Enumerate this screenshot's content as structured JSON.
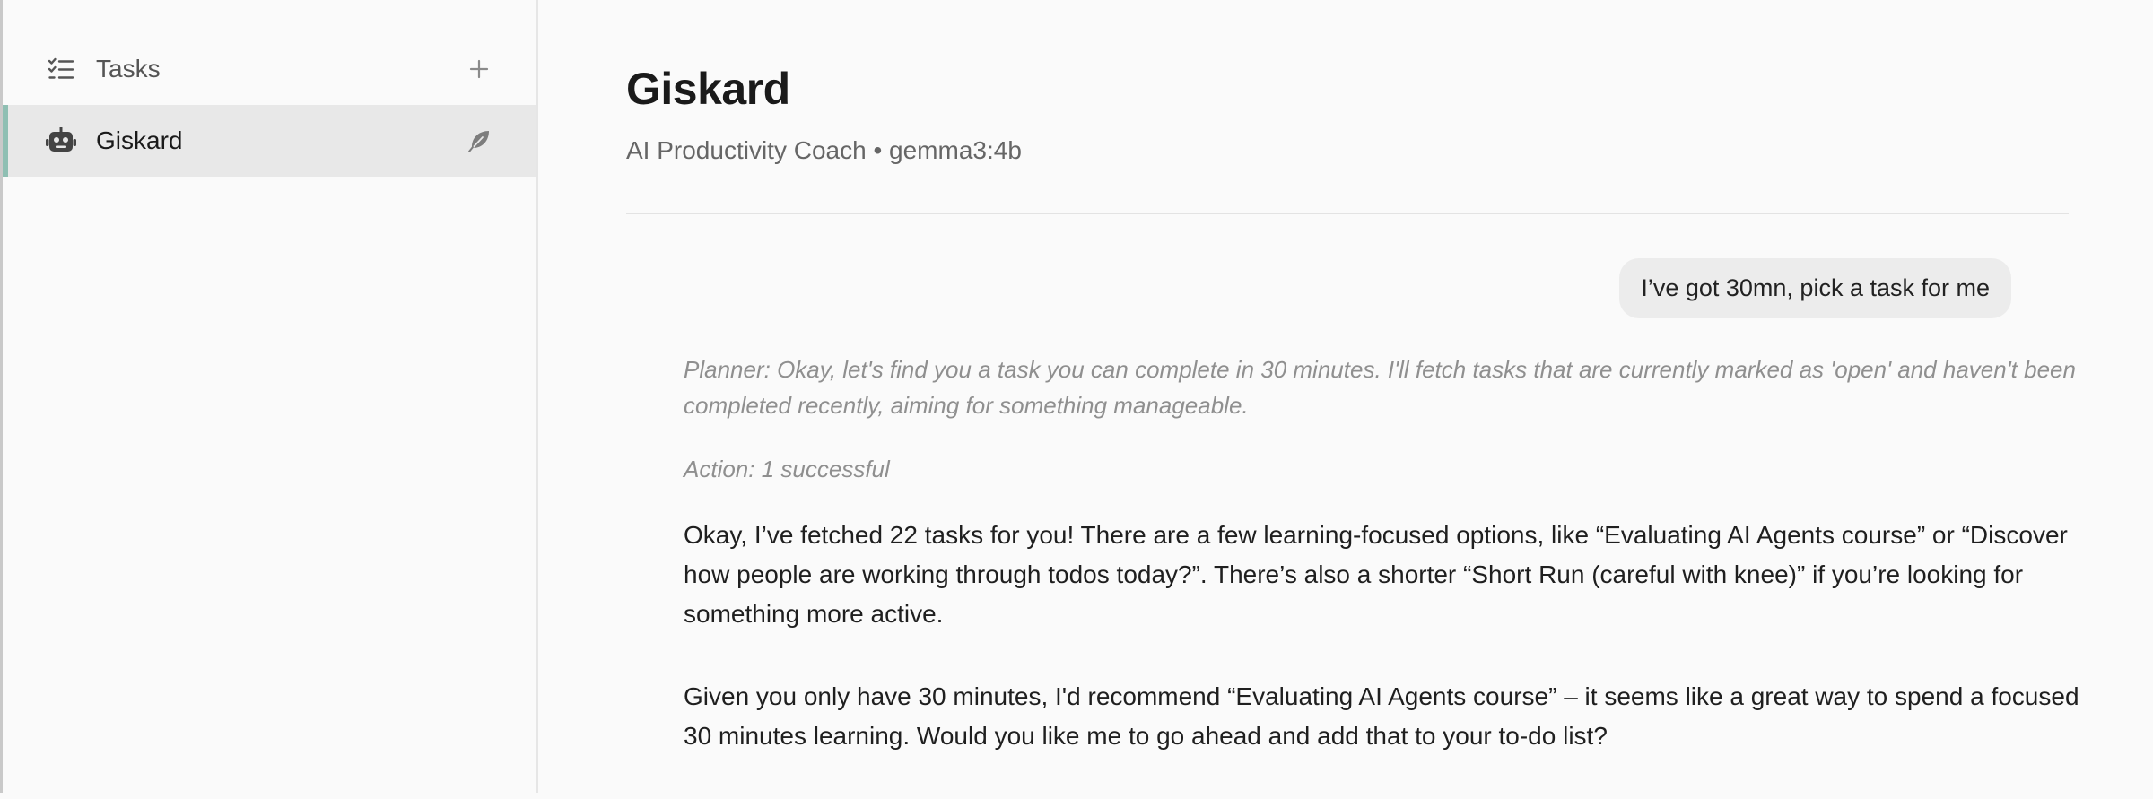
{
  "sidebar": {
    "items": [
      {
        "label": "Tasks",
        "icon": "checklist-icon",
        "action_icon": "plus-icon"
      },
      {
        "label": "Giskard",
        "icon": "robot-icon",
        "action_icon": "feather-icon"
      }
    ],
    "accent_color": "#8fbfb3"
  },
  "header": {
    "title": "Giskard",
    "subtitle": "AI Productivity Coach • gemma3:4b"
  },
  "chat": {
    "user_message": "I’ve got 30mn, pick a task for me",
    "planner": "Planner: Okay, let's find you a task you can complete in 30 minutes. I'll fetch tasks that are currently marked as 'open' and haven't been completed recently, aiming for something manageable.",
    "action": "Action: 1 successful",
    "reply_paragraphs": [
      "Okay, I’ve fetched 22 tasks for you! There are a few learning-focused options, like “Evaluating AI Agents course” or “Discover how people are working through todos today?”. There’s also a shorter “Short Run (careful with knee)” if you’re looking for something more active.",
      "Given you only have 30 minutes, I'd recommend “Evaluating AI Agents course” – it seems like a great way to spend a focused 30 minutes learning. Would you like me to go ahead and add that to your to-do list?"
    ]
  }
}
